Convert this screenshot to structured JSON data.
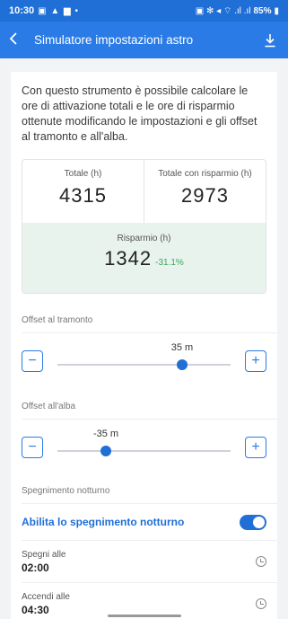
{
  "status_bar": {
    "time": "10:30",
    "left_icons": "▣ ▲ ▆ •",
    "right_icons": "▣ ✻ ◂ ⌔ .ıl .ıl",
    "battery": "85%"
  },
  "app_bar": {
    "back_icon": "chevron-left-icon",
    "title": "Simulatore impostazioni astro",
    "download_icon": "download-icon"
  },
  "intro": "Con questo strumento è possibile calcolare le ore di attivazione totali e le ore di risparmio ottenute modificando le impostazioni e gli offset al tramonto e all'alba.",
  "summary": {
    "total_label": "Totale (h)",
    "total_value": "4315",
    "total_saving_label": "Totale con risparmio (h)",
    "total_saving_value": "2973",
    "saving_label": "Risparmio (h)",
    "saving_value": "1342",
    "saving_pct": "-31.1%"
  },
  "sunset_offset": {
    "label": "Offset al tramonto",
    "value_text": "35 m",
    "value_fraction": 0.72
  },
  "sunrise_offset": {
    "label": "Offset all'alba",
    "value_text": "-35 m",
    "value_fraction": 0.28
  },
  "night_off": {
    "section_label": "Spegnimento notturno",
    "toggle_label": "Abilita lo spegnimento notturno",
    "toggle_on": true,
    "off_at_label": "Spegni alle",
    "off_at_value": "02:00",
    "on_at_label": "Accendi alle",
    "on_at_value": "04:30"
  },
  "colors": {
    "primary": "#2a7be5",
    "status_bar": "#1f6fd6",
    "saving_bg": "#e9f3ed",
    "saving_pct": "#3ba55d"
  }
}
